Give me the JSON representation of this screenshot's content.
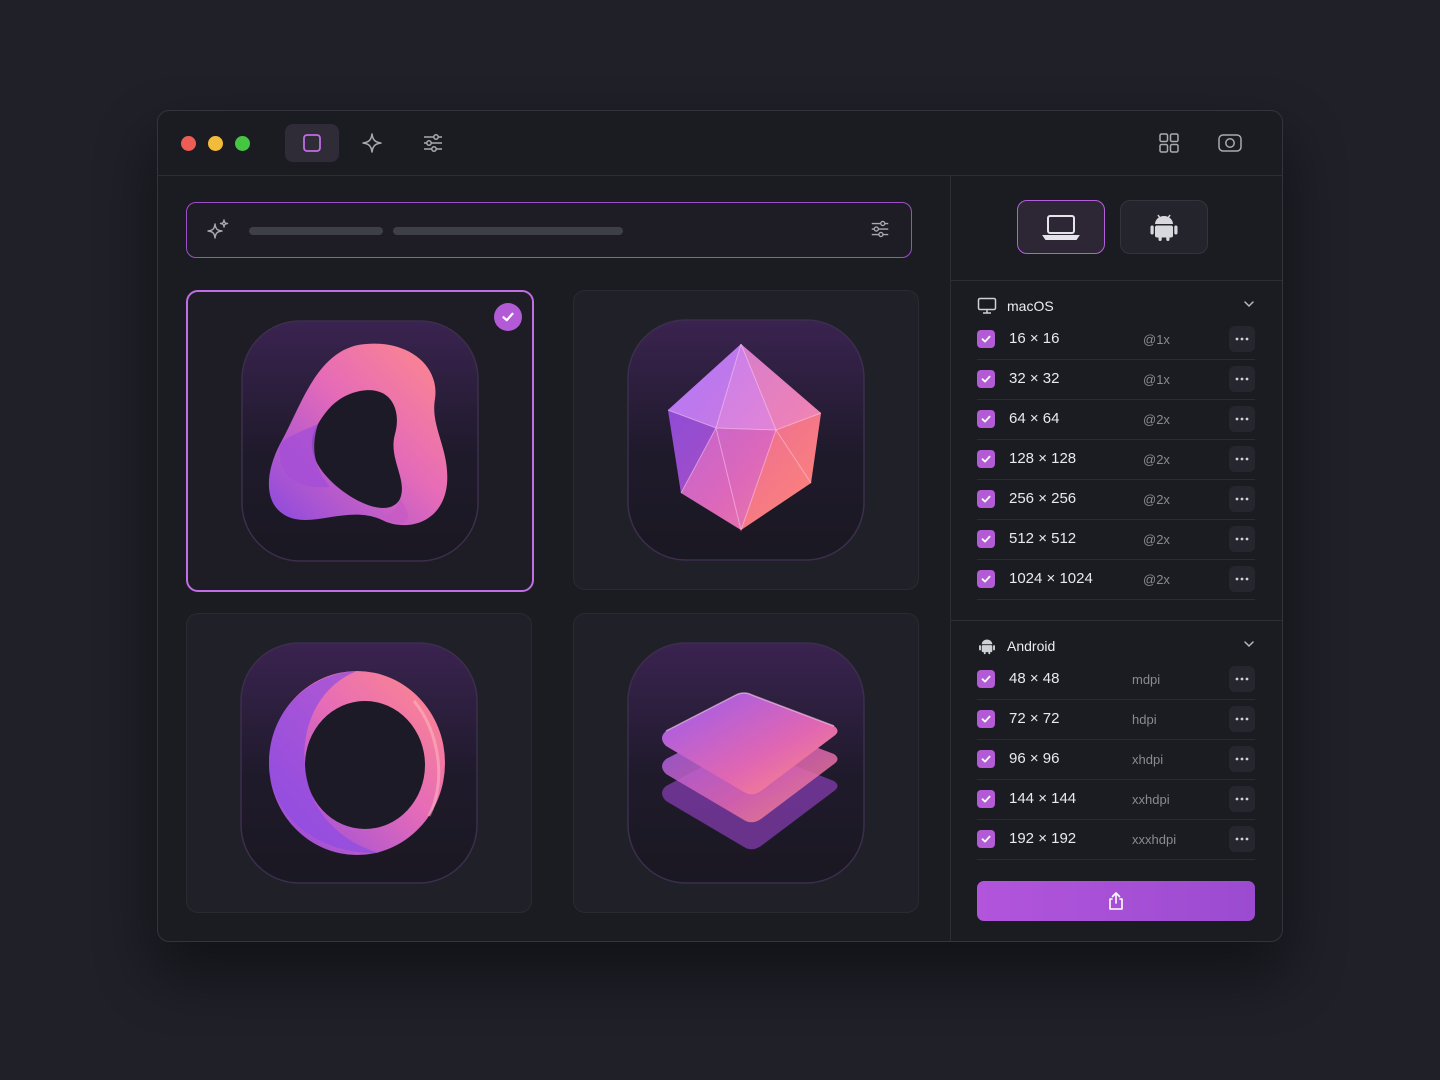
{
  "toolbar": {
    "tabs": [
      {
        "icon": "square-icon",
        "active": true
      },
      {
        "icon": "sparkle-icon",
        "active": false
      },
      {
        "icon": "sliders-icon",
        "active": false
      }
    ],
    "right": [
      {
        "icon": "grid-icon"
      },
      {
        "icon": "camera-icon"
      }
    ]
  },
  "prompt": {
    "icon": "sparkles-icon",
    "filter_icon": "sliders-icon"
  },
  "gallery": [
    {
      "name": "ribbon",
      "selected": true
    },
    {
      "name": "gem",
      "selected": false
    },
    {
      "name": "ring",
      "selected": false
    },
    {
      "name": "layers",
      "selected": false
    }
  ],
  "platform_tabs": [
    {
      "icon": "laptop-icon",
      "active": true
    },
    {
      "icon": "android-icon",
      "active": false
    }
  ],
  "macos": {
    "title": "macOS",
    "rows": [
      {
        "size": "16 × 16",
        "scale": "@1x"
      },
      {
        "size": "32 × 32",
        "scale": "@1x"
      },
      {
        "size": "64 × 64",
        "scale": "@2x"
      },
      {
        "size": "128 × 128",
        "scale": "@2x"
      },
      {
        "size": "256 × 256",
        "scale": "@2x"
      },
      {
        "size": "512 × 512",
        "scale": "@2x"
      },
      {
        "size": "1024 × 1024",
        "scale": "@2x"
      }
    ]
  },
  "android": {
    "title": "Android",
    "rows": [
      {
        "size": "48 × 48",
        "scale": "mdpi"
      },
      {
        "size": "72 × 72",
        "scale": "hdpi"
      },
      {
        "size": "96 × 96",
        "scale": "xhdpi"
      },
      {
        "size": "144 × 144",
        "scale": "xxhdpi"
      },
      {
        "size": "192 × 192",
        "scale": "xxxhdpi"
      }
    ]
  },
  "colors": {
    "accent": "#b35ad6",
    "background": "#1f2028",
    "window": "#1b1c22"
  },
  "export_icon": "share-icon"
}
